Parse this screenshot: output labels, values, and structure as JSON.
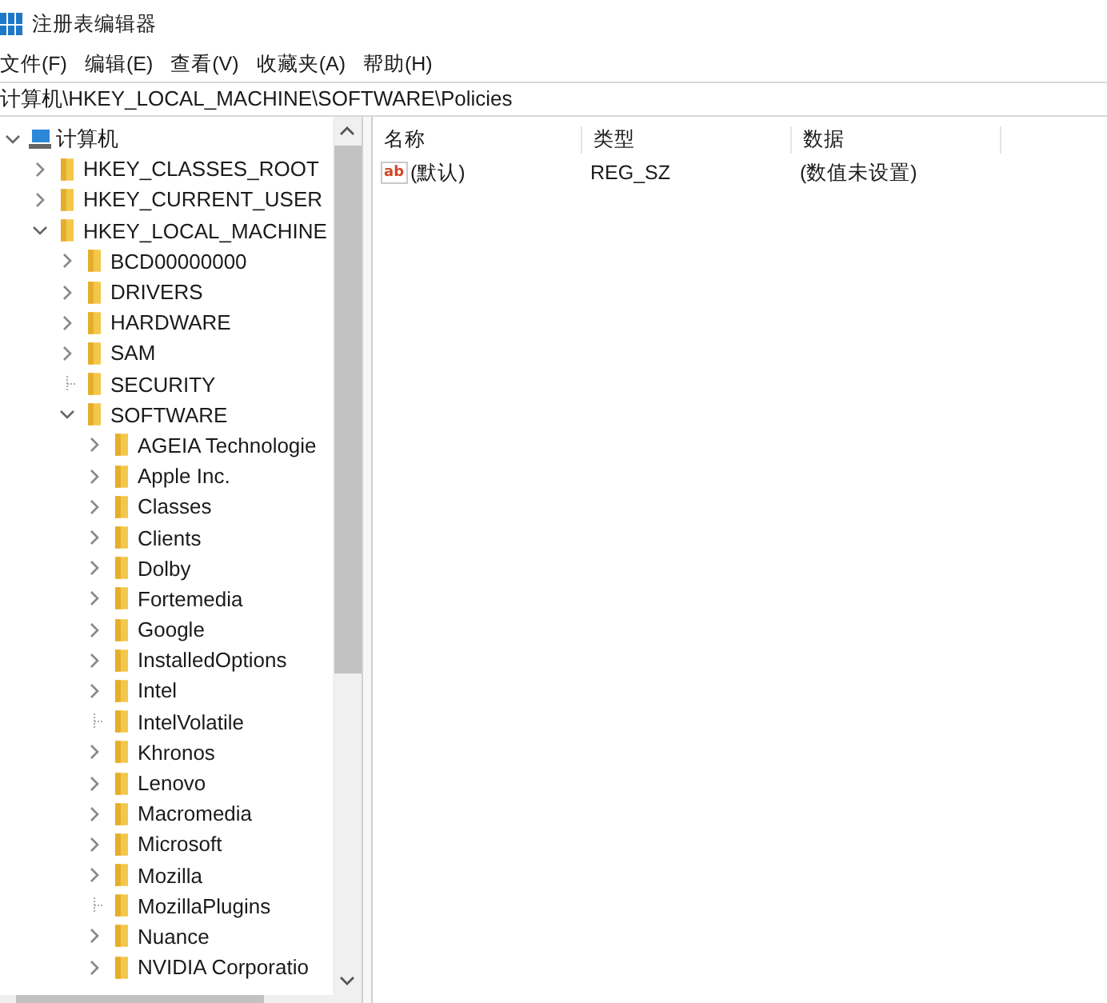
{
  "window": {
    "title": "注册表编辑器"
  },
  "menu": [
    "文件(F)",
    "编辑(E)",
    "查看(V)",
    "收藏夹(A)",
    "帮助(H)"
  ],
  "address": "计算机\\HKEY_LOCAL_MACHINE\\SOFTWARE\\Policies",
  "tree": [
    {
      "label": "计算机",
      "kind": "branch",
      "expanded": true,
      "children": [
        {
          "label": "HKEY_CLASSES_ROOT",
          "kind": "branch",
          "expanded": false
        },
        {
          "label": "HKEY_CURRENT_USER",
          "kind": "branch",
          "expanded": false
        },
        {
          "label": "HKEY_LOCAL_MACHINE",
          "kind": "branch",
          "expanded": true,
          "children": [
            {
              "label": "BCD00000000",
              "kind": "branch",
              "expanded": false
            },
            {
              "label": "DRIVERS",
              "kind": "branch",
              "expanded": false
            },
            {
              "label": "HARDWARE",
              "kind": "branch",
              "expanded": false
            },
            {
              "label": "SAM",
              "kind": "branch",
              "expanded": false
            },
            {
              "label": "SECURITY",
              "kind": "leaf",
              "expanded": false
            },
            {
              "label": "SOFTWARE",
              "kind": "branch",
              "expanded": true,
              "children": [
                {
                  "label": "AGEIA Technologie",
                  "kind": "branch",
                  "expanded": false
                },
                {
                  "label": "Apple Inc.",
                  "kind": "branch",
                  "expanded": false
                },
                {
                  "label": "Classes",
                  "kind": "branch",
                  "expanded": false
                },
                {
                  "label": "Clients",
                  "kind": "branch",
                  "expanded": false
                },
                {
                  "label": "Dolby",
                  "kind": "branch",
                  "expanded": false
                },
                {
                  "label": "Fortemedia",
                  "kind": "branch",
                  "expanded": false
                },
                {
                  "label": "Google",
                  "kind": "branch",
                  "expanded": false
                },
                {
                  "label": "InstalledOptions",
                  "kind": "branch",
                  "expanded": false
                },
                {
                  "label": "Intel",
                  "kind": "branch",
                  "expanded": false
                },
                {
                  "label": "IntelVolatile",
                  "kind": "leaf",
                  "expanded": false
                },
                {
                  "label": "Khronos",
                  "kind": "branch",
                  "expanded": false
                },
                {
                  "label": "Lenovo",
                  "kind": "branch",
                  "expanded": false
                },
                {
                  "label": "Macromedia",
                  "kind": "branch",
                  "expanded": false
                },
                {
                  "label": "Microsoft",
                  "kind": "branch",
                  "expanded": false
                },
                {
                  "label": "Mozilla",
                  "kind": "branch",
                  "expanded": false
                },
                {
                  "label": "MozillaPlugins",
                  "kind": "leaf",
                  "expanded": false
                },
                {
                  "label": "Nuance",
                  "kind": "branch",
                  "expanded": false
                },
                {
                  "label": "NVIDIA Corporatio",
                  "kind": "branch",
                  "expanded": false
                }
              ]
            }
          ]
        }
      ]
    }
  ],
  "values": {
    "columns": [
      "名称",
      "类型",
      "数据"
    ],
    "rows": [
      {
        "icon": "ab",
        "name": "(默认)",
        "type": "REG_SZ",
        "data": "(数值未设置)"
      }
    ]
  }
}
